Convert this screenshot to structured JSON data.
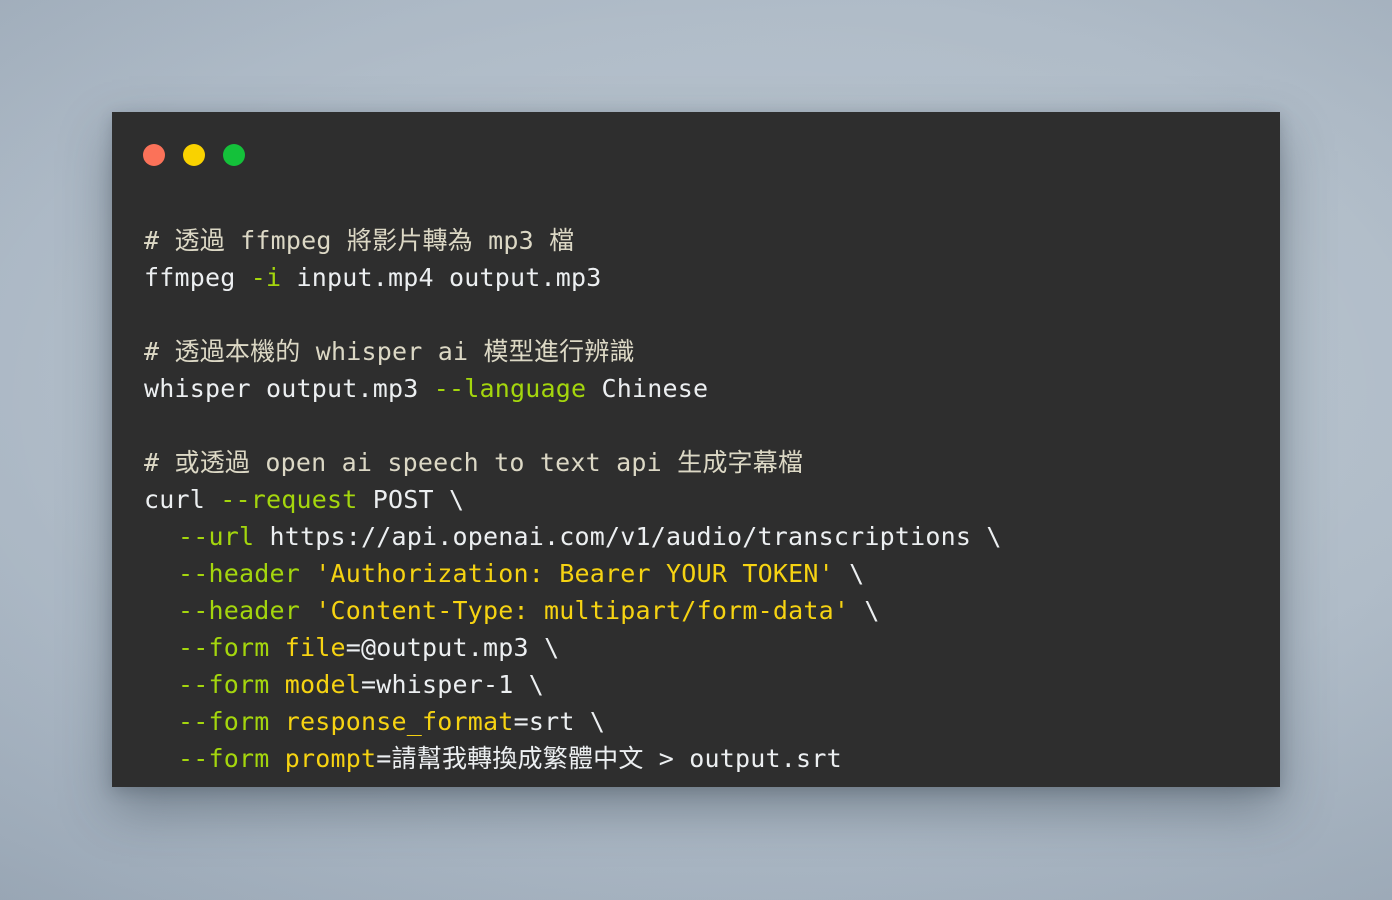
{
  "window": {
    "background_color": "#2e2e2e",
    "desktop_background_color": "#aab7c4",
    "traffic_lights": [
      {
        "name": "close",
        "label": "Close",
        "color": "#fb7259"
      },
      {
        "name": "minimize",
        "label": "Minimize",
        "color": "#f9d200"
      },
      {
        "name": "maximize",
        "label": "Maximize",
        "color": "#14c13a"
      }
    ]
  },
  "colors": {
    "comment": "#dcd8c5",
    "plain": "#eceff1",
    "flag": "#a4d60d",
    "string": "#f6d312",
    "key": "#f6d312"
  },
  "terminal": {
    "lines": [
      {
        "id": "line-1-comment-ffmpeg",
        "indent": false,
        "tokens": [
          {
            "type": "comment",
            "text": "# 透過 ffmpeg 將影片轉為 mp3 檔"
          }
        ]
      },
      {
        "id": "line-2-ffmpeg-command",
        "indent": false,
        "tokens": [
          {
            "type": "plain",
            "text": "ffmpeg "
          },
          {
            "type": "flag",
            "text": "-i"
          },
          {
            "type": "plain",
            "text": " input.mp4 output.mp3"
          }
        ]
      },
      {
        "id": "line-3-blank",
        "indent": false,
        "tokens": []
      },
      {
        "id": "line-4-comment-whisper",
        "indent": false,
        "tokens": [
          {
            "type": "comment",
            "text": "# 透過本機的 whisper ai 模型進行辨識"
          }
        ]
      },
      {
        "id": "line-5-whisper-command",
        "indent": false,
        "tokens": [
          {
            "type": "plain",
            "text": "whisper output.mp3 "
          },
          {
            "type": "flag",
            "text": "--language"
          },
          {
            "type": "plain",
            "text": " Chinese"
          }
        ]
      },
      {
        "id": "line-6-blank",
        "indent": false,
        "tokens": []
      },
      {
        "id": "line-7-comment-openai",
        "indent": false,
        "tokens": [
          {
            "type": "comment",
            "text": "# 或透過 open ai speech to text api 生成字幕檔"
          }
        ]
      },
      {
        "id": "line-8-curl-request",
        "indent": false,
        "tokens": [
          {
            "type": "plain",
            "text": "curl "
          },
          {
            "type": "flag",
            "text": "--request"
          },
          {
            "type": "plain",
            "text": " POST \\"
          }
        ]
      },
      {
        "id": "line-9-curl-url",
        "indent": true,
        "tokens": [
          {
            "type": "flag",
            "text": "--url"
          },
          {
            "type": "plain",
            "text": " https://api.openai.com/v1/audio/transcriptions \\"
          }
        ]
      },
      {
        "id": "line-10-curl-header-auth",
        "indent": true,
        "tokens": [
          {
            "type": "flag",
            "text": "--header"
          },
          {
            "type": "plain",
            "text": " "
          },
          {
            "type": "string",
            "text": "'Authorization: Bearer YOUR TOKEN'"
          },
          {
            "type": "plain",
            "text": " \\"
          }
        ]
      },
      {
        "id": "line-11-curl-header-content-type",
        "indent": true,
        "tokens": [
          {
            "type": "flag",
            "text": "--header"
          },
          {
            "type": "plain",
            "text": " "
          },
          {
            "type": "string",
            "text": "'Content-Type: multipart/form-data'"
          },
          {
            "type": "plain",
            "text": " \\"
          }
        ]
      },
      {
        "id": "line-12-curl-form-file",
        "indent": true,
        "tokens": [
          {
            "type": "flag",
            "text": "--form"
          },
          {
            "type": "plain",
            "text": " "
          },
          {
            "type": "key",
            "text": "file"
          },
          {
            "type": "plain",
            "text": "=@output.mp3 \\"
          }
        ]
      },
      {
        "id": "line-13-curl-form-model",
        "indent": true,
        "tokens": [
          {
            "type": "flag",
            "text": "--form"
          },
          {
            "type": "plain",
            "text": " "
          },
          {
            "type": "key",
            "text": "model"
          },
          {
            "type": "plain",
            "text": "=whisper-1 \\"
          }
        ]
      },
      {
        "id": "line-14-curl-form-response-format",
        "indent": true,
        "tokens": [
          {
            "type": "flag",
            "text": "--form"
          },
          {
            "type": "plain",
            "text": " "
          },
          {
            "type": "key",
            "text": "response_format"
          },
          {
            "type": "plain",
            "text": "=srt \\"
          }
        ]
      },
      {
        "id": "line-15-curl-form-prompt",
        "indent": true,
        "tokens": [
          {
            "type": "flag",
            "text": "--form"
          },
          {
            "type": "plain",
            "text": " "
          },
          {
            "type": "key",
            "text": "prompt"
          },
          {
            "type": "plain",
            "text": "=請幫我轉換成繁體中文 > output.srt"
          }
        ]
      }
    ]
  }
}
